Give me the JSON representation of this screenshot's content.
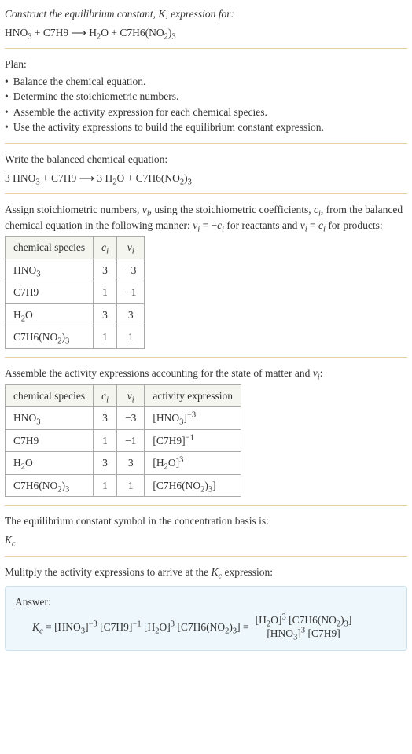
{
  "header": {
    "prompt_prefix": "Construct the equilibrium constant, ",
    "prompt_mid": ", expression for:",
    "K": "K"
  },
  "eq_unbalanced": {
    "r1": "HNO",
    "r1s": "3",
    "plus1": " + ",
    "r2": "C7H9",
    "arrow": "  ⟶  ",
    "p1": "H",
    "p1s": "2",
    "p1t": "O",
    "plus2": " + ",
    "p2": "C7H6(NO",
    "p2s": "2",
    "p2t": ")",
    "p2u": "3"
  },
  "plan": {
    "title": "Plan:",
    "b1": "Balance the chemical equation.",
    "b2": "Determine the stoichiometric numbers.",
    "b3": "Assemble the activity expression for each chemical species.",
    "b4": "Use the activity expressions to build the equilibrium constant expression."
  },
  "balanced": {
    "intro": "Write the balanced chemical equation:",
    "c_r1": "3 ",
    "r1": "HNO",
    "r1s": "3",
    "plus1": " + ",
    "r2": "C7H9",
    "arrow": "  ⟶  ",
    "c_p1": "3 ",
    "p1": "H",
    "p1s": "2",
    "p1t": "O",
    "plus2": " + ",
    "p2": "C7H6(NO",
    "p2s": "2",
    "p2t": ")",
    "p2u": "3"
  },
  "stoich": {
    "intro_a": "Assign stoichiometric numbers, ",
    "v": "ν",
    "vi": "i",
    "intro_b": ", using the stoichiometric coefficients, ",
    "c": "c",
    "ci": "i",
    "intro_c": ", from the balanced chemical equation in the following manner: ",
    "rel_react_a": "ν",
    "rel_react_b": "i",
    "rel_react_c": " = −",
    "rel_react_d": "c",
    "rel_react_e": "i",
    "intro_d": " for reactants and ",
    "rel_prod_a": "ν",
    "rel_prod_b": "i",
    "rel_prod_c": " = ",
    "rel_prod_d": "c",
    "rel_prod_e": "i",
    "intro_e": " for products:",
    "hdr_species": "chemical species",
    "hdr_c_sym": "c",
    "hdr_c_sub": "i",
    "hdr_v_sym": "ν",
    "hdr_v_sub": "i",
    "rows": [
      {
        "sp_a": "HNO",
        "sp_b": "3",
        "sp_c": "",
        "sp_d": "",
        "c": "3",
        "v": "−3"
      },
      {
        "sp_a": "C7H9",
        "sp_b": "",
        "sp_c": "",
        "sp_d": "",
        "c": "1",
        "v": "−1"
      },
      {
        "sp_a": "H",
        "sp_b": "2",
        "sp_c": "O",
        "sp_d": "",
        "c": "3",
        "v": "3"
      },
      {
        "sp_a": "C7H6(NO",
        "sp_b": "2",
        "sp_c": ")",
        "sp_d": "3",
        "c": "1",
        "v": "1"
      }
    ]
  },
  "activity": {
    "intro_a": "Assemble the activity expressions accounting for the state of matter and ",
    "v": "ν",
    "vi": "i",
    "intro_b": ":",
    "hdr_species": "chemical species",
    "hdr_c_sym": "c",
    "hdr_c_sub": "i",
    "hdr_v_sym": "ν",
    "hdr_v_sub": "i",
    "hdr_act": "activity expression",
    "rows": [
      {
        "sp_a": "HNO",
        "sp_b": "3",
        "sp_c": "",
        "sp_d": "",
        "c": "3",
        "v": "−3",
        "ae_a": "[HNO",
        "ae_b": "3",
        "ae_c": "]",
        "ae_p": "−3"
      },
      {
        "sp_a": "C7H9",
        "sp_b": "",
        "sp_c": "",
        "sp_d": "",
        "c": "1",
        "v": "−1",
        "ae_a": "[C7H9]",
        "ae_b": "",
        "ae_c": "",
        "ae_p": "−1"
      },
      {
        "sp_a": "H",
        "sp_b": "2",
        "sp_c": "O",
        "sp_d": "",
        "c": "3",
        "v": "3",
        "ae_a": "[H",
        "ae_b": "2",
        "ae_c": "O]",
        "ae_p": "3"
      },
      {
        "sp_a": "C7H6(NO",
        "sp_b": "2",
        "sp_c": ")",
        "sp_d": "3",
        "c": "1",
        "v": "1",
        "ae_a": "[C7H6(NO",
        "ae_b": "2",
        "ae_c": ")",
        "ae_d": "3",
        "ae_e": "]",
        "ae_p": ""
      }
    ]
  },
  "kc_symbol": {
    "intro": "The equilibrium constant symbol in the concentration basis is:",
    "K": "K",
    "c": "c"
  },
  "multiply": {
    "intro_a": "Mulitply the activity expressions to arrive at the ",
    "K": "K",
    "c": "c",
    "intro_b": " expression:"
  },
  "answer": {
    "label": "Answer:",
    "K": "K",
    "c": "c",
    "eq": " = ",
    "t1a": "[HNO",
    "t1b": "3",
    "t1c": "]",
    "t1p": "−3",
    "sp": " ",
    "t2a": "[C7H9]",
    "t2p": "−1",
    "t3a": "[H",
    "t3b": "2",
    "t3c": "O]",
    "t3p": "3",
    "t4a": "[C7H6(NO",
    "t4b": "2",
    "t4c": ")",
    "t4d": "3",
    "t4e": "]",
    "eq2": " = ",
    "num_a": "[H",
    "num_b": "2",
    "num_c": "O]",
    "num_p": "3",
    "num_sp": " ",
    "num_d": "[C7H6(NO",
    "num_e": "2",
    "num_f": ")",
    "num_g": "3",
    "num_h": "]",
    "den_a": "[HNO",
    "den_b": "3",
    "den_c": "]",
    "den_p": "3",
    "den_sp": " ",
    "den_d": "[C7H9]"
  }
}
